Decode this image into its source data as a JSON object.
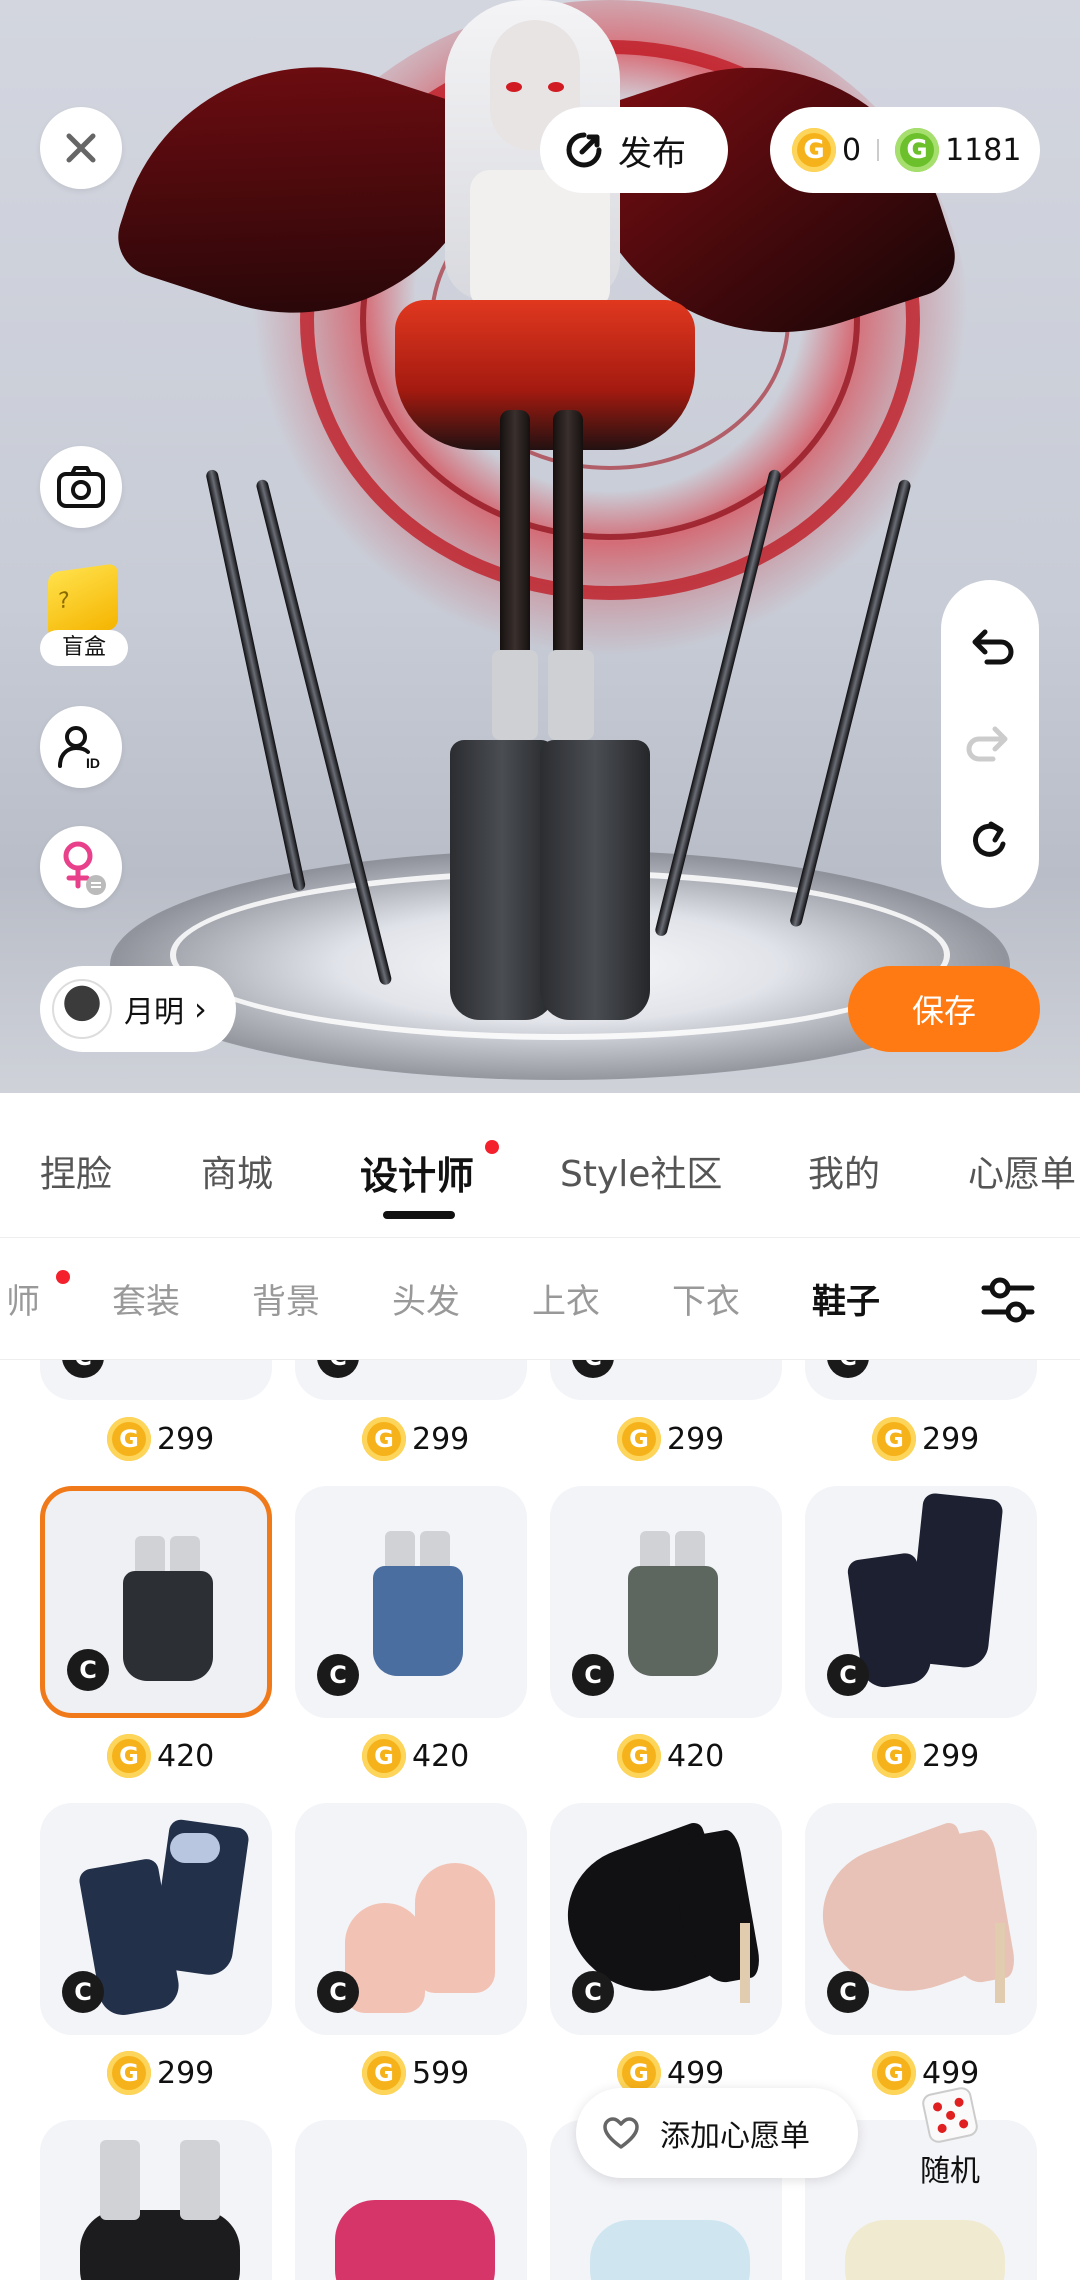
{
  "top_bar": {
    "publish_label": "发布",
    "coins": [
      {
        "icon": "gold-coin-icon",
        "value": "0"
      },
      {
        "icon": "green-coin-icon",
        "value": "1181"
      }
    ]
  },
  "side_tools": {
    "blind_box_label": "盲盒"
  },
  "user": {
    "name": "月明"
  },
  "save_label": "保存",
  "main_tabs": [
    {
      "label": "捏脸"
    },
    {
      "label": "商城"
    },
    {
      "label": "设计师",
      "active": true,
      "dot": true
    },
    {
      "label": "Style社区"
    },
    {
      "label": "我的"
    },
    {
      "label": "心愿单"
    }
  ],
  "sub_tabs": [
    {
      "label": "师",
      "dot": true
    },
    {
      "label": "套装"
    },
    {
      "label": "背景"
    },
    {
      "label": "头发"
    },
    {
      "label": "上衣"
    },
    {
      "label": "下衣"
    },
    {
      "label": "鞋子",
      "active": true
    }
  ],
  "items": {
    "row0_prices": [
      "299",
      "299",
      "299",
      "299"
    ],
    "row1": [
      {
        "price": "420",
        "selected": true,
        "color": "#2c2f34"
      },
      {
        "price": "420",
        "color": "#4b6ea0"
      },
      {
        "price": "420",
        "color": "#5e6660"
      },
      {
        "price": "299",
        "color": "#1c2030"
      }
    ],
    "row2": [
      {
        "price": "299",
        "color": "#23304a"
      },
      {
        "price": "599",
        "color": "#f2c2b4"
      },
      {
        "price": "499",
        "color": "#111114"
      },
      {
        "price": "499",
        "color": "#e8c2b6"
      }
    ],
    "c_badge": "C",
    "coin_letter": "G"
  },
  "wishlist_label": "添加心愿单",
  "random_label": "随机",
  "colors": {
    "accent_orange": "#ff7a12",
    "selected_border": "#f07a1a",
    "red_dot": "#f4212c",
    "gold_coin": "#f6b21a",
    "green_coin": "#6cc02c"
  }
}
